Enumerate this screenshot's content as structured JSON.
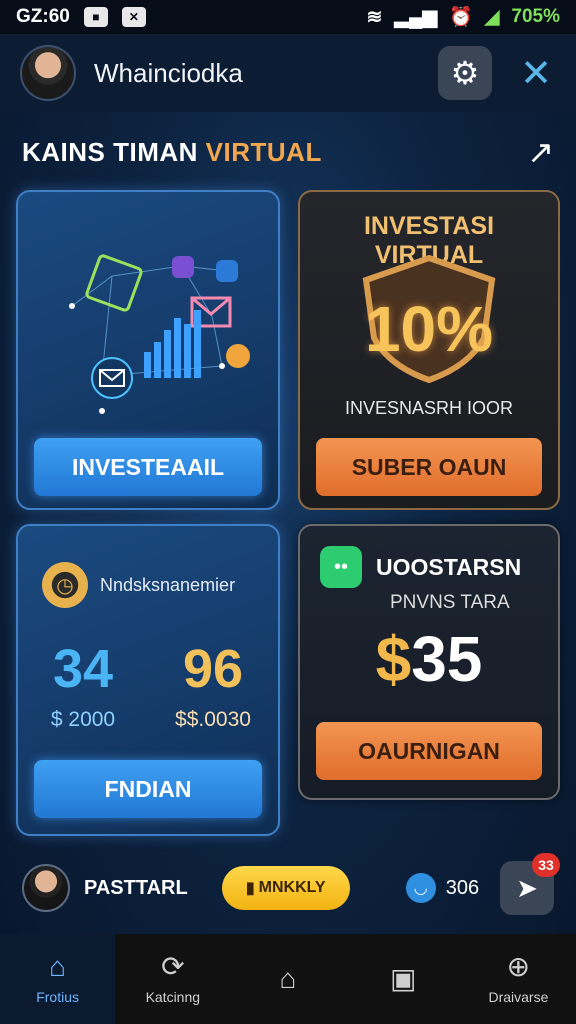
{
  "status_bar": {
    "time": "GZ:60",
    "battery": "705%"
  },
  "header": {
    "title": "Whainciodka",
    "settings_icon": "settings-icon",
    "close_icon": "close-icon"
  },
  "section": {
    "title_white": "KAINS TIMAN",
    "title_gold": "VIRTUAL",
    "arrow": "↗"
  },
  "cards": {
    "network": {
      "button_label": "INVESTEAAIL"
    },
    "virtual": {
      "title": "INVESTASI VIRTUAL",
      "percent": "10%",
      "subtitle": "INVESNASRH IOOR",
      "button_label": "SUBER OAUN"
    },
    "stats": {
      "label": "Nndsksnanemier",
      "left_value": "34",
      "left_amount": "$ 2000",
      "right_value": "96",
      "right_amount": "$.0030",
      "right_currency": "$",
      "button_label": "FNDIAN"
    },
    "price": {
      "title": "UOOSTARSN",
      "subtitle": "PNVNS TARA",
      "currency": "$",
      "amount": "35",
      "button_label": "OAURNIGAN"
    }
  },
  "footer_row": {
    "name": "PASTTARL",
    "pill_label": "MNKKLY",
    "coin_value": "306",
    "notification_count": "33"
  },
  "bottom_nav": [
    {
      "label": "Frotius",
      "icon": "home-icon"
    },
    {
      "label": "Katcinng",
      "icon": "refresh-icon"
    },
    {
      "label": "",
      "icon": "house-outline-icon"
    },
    {
      "label": "",
      "icon": "info-icon"
    },
    {
      "label": "Draivarse",
      "icon": "search-icon"
    }
  ],
  "colors": {
    "accent_blue": "#2178d4",
    "accent_orange": "#e06d2b",
    "gold": "#f2c15c"
  }
}
